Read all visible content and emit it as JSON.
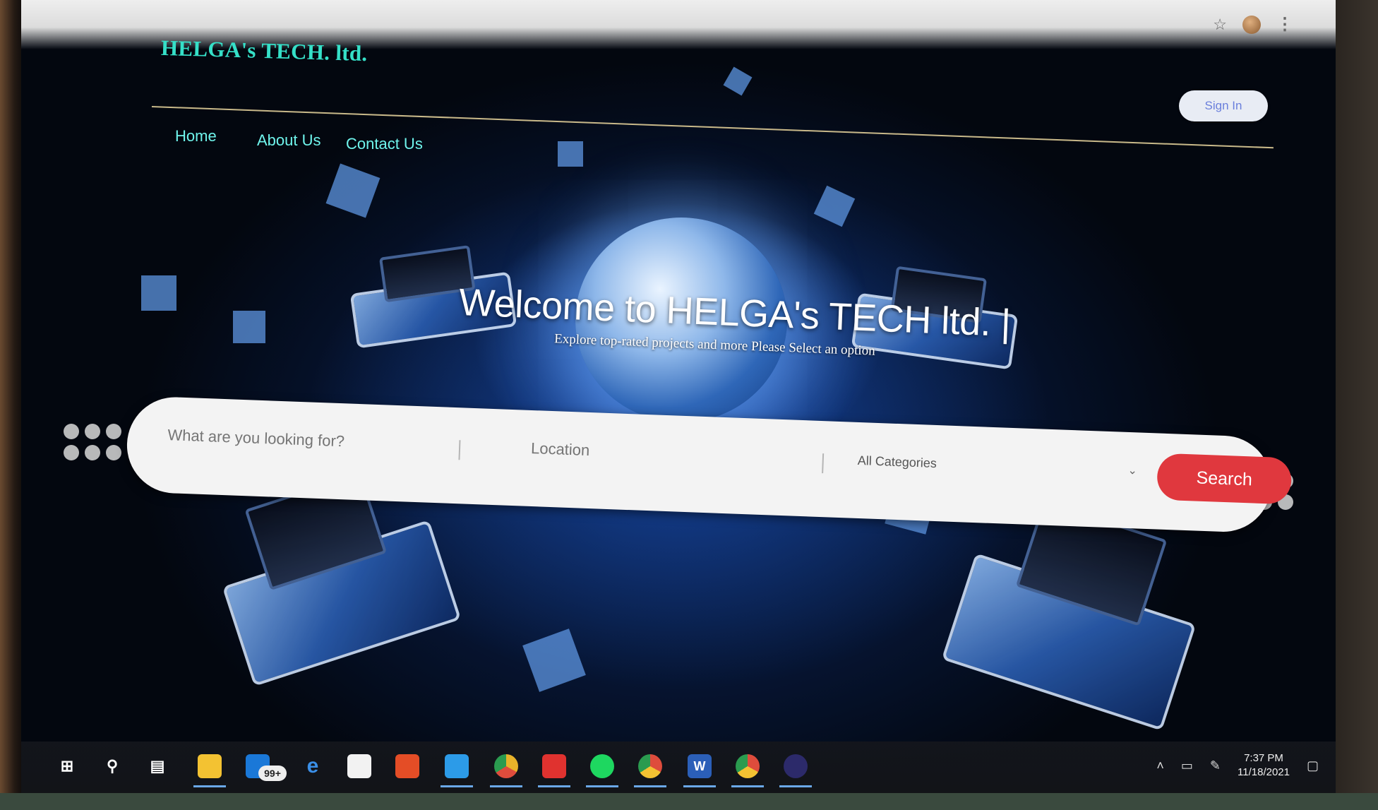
{
  "header": {
    "logo_text": "HELGA's TECH. ltd.",
    "nav": [
      {
        "label": "Home"
      },
      {
        "label": "About Us"
      },
      {
        "label": "Contact Us"
      }
    ],
    "signin_label": "Sign In"
  },
  "hero": {
    "title": "Welcome to HELGA's TECH ltd. |",
    "subtitle": "Explore top-rated projects and more Please Select an option"
  },
  "search": {
    "what_placeholder": "What are you looking for?",
    "location_placeholder": "Location",
    "category_selected": "All Categories",
    "button_label": "Search"
  },
  "browser": {
    "icons": [
      "star-icon",
      "profile-icon",
      "menu-dots-icon"
    ]
  },
  "taskbar": {
    "mail_badge": "99+",
    "clock_time": "7:37 PM",
    "clock_date": "11/18/2021",
    "icons": [
      "windows-start-icon",
      "search-icon",
      "task-view-icon",
      "file-explorer-icon",
      "mail-icon",
      "edge-icon",
      "store-icon",
      "office-icon",
      "app-icon",
      "chrome-canary-icon",
      "brave-icon",
      "spotify-icon",
      "chrome-icon",
      "word-icon",
      "chrome-profile-icon",
      "eclipse-icon"
    ]
  },
  "colors": {
    "logo": "#35e0c8",
    "nav_link": "#6ff4ec",
    "search_button": "#e0383e",
    "signin_text": "#6a7fdc"
  }
}
